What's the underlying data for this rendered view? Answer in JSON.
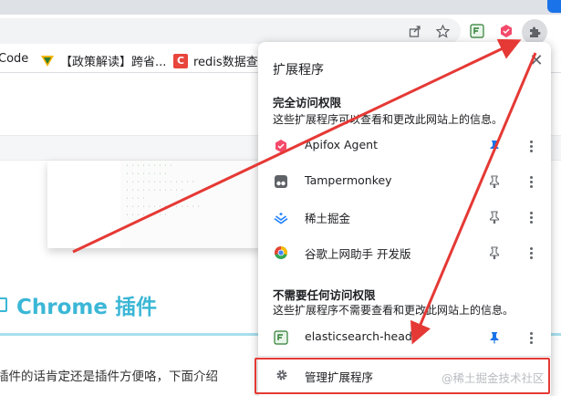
{
  "bookmarks": {
    "items": [
      {
        "label": "Code"
      },
      {
        "label": "【政策解读】跨省..."
      },
      {
        "label": "redis数据查看"
      }
    ]
  },
  "page": {
    "heading": "Chrome 插件",
    "paragraph": "插件的话肯定还是插件方便咯，下面介绍"
  },
  "popup": {
    "title": "扩展程序",
    "full_access": {
      "title": "完全访问权限",
      "desc": "这些扩展程序可以查看和更改此网站上的信息。",
      "items": [
        {
          "name": "Apifox Agent",
          "pinned": true
        },
        {
          "name": "Tampermonkey",
          "pinned": false
        },
        {
          "name": "稀土掘金",
          "pinned": false
        },
        {
          "name": "谷歌上网助手 开发版",
          "pinned": false
        }
      ]
    },
    "no_access": {
      "title": "不需要任何访问权限",
      "desc": "这些扩展程序不需要查看和更改此网站上的信息。",
      "items": [
        {
          "name": "elasticsearch-head",
          "pinned": true
        }
      ]
    },
    "manage_label": "管理扩展程序"
  },
  "watermark": "@稀土掘金技术社区",
  "colors": {
    "accent_blue": "#1a73e8",
    "annotation_red": "#e53935",
    "heading_teal": "#3bb7d6"
  },
  "icons": {
    "share": "share-icon",
    "star": "star-icon",
    "extensions": "puzzle-icon",
    "close": "close-icon",
    "pin": "pin-icon",
    "more": "more-vert-icon",
    "settings": "gear-icon"
  }
}
